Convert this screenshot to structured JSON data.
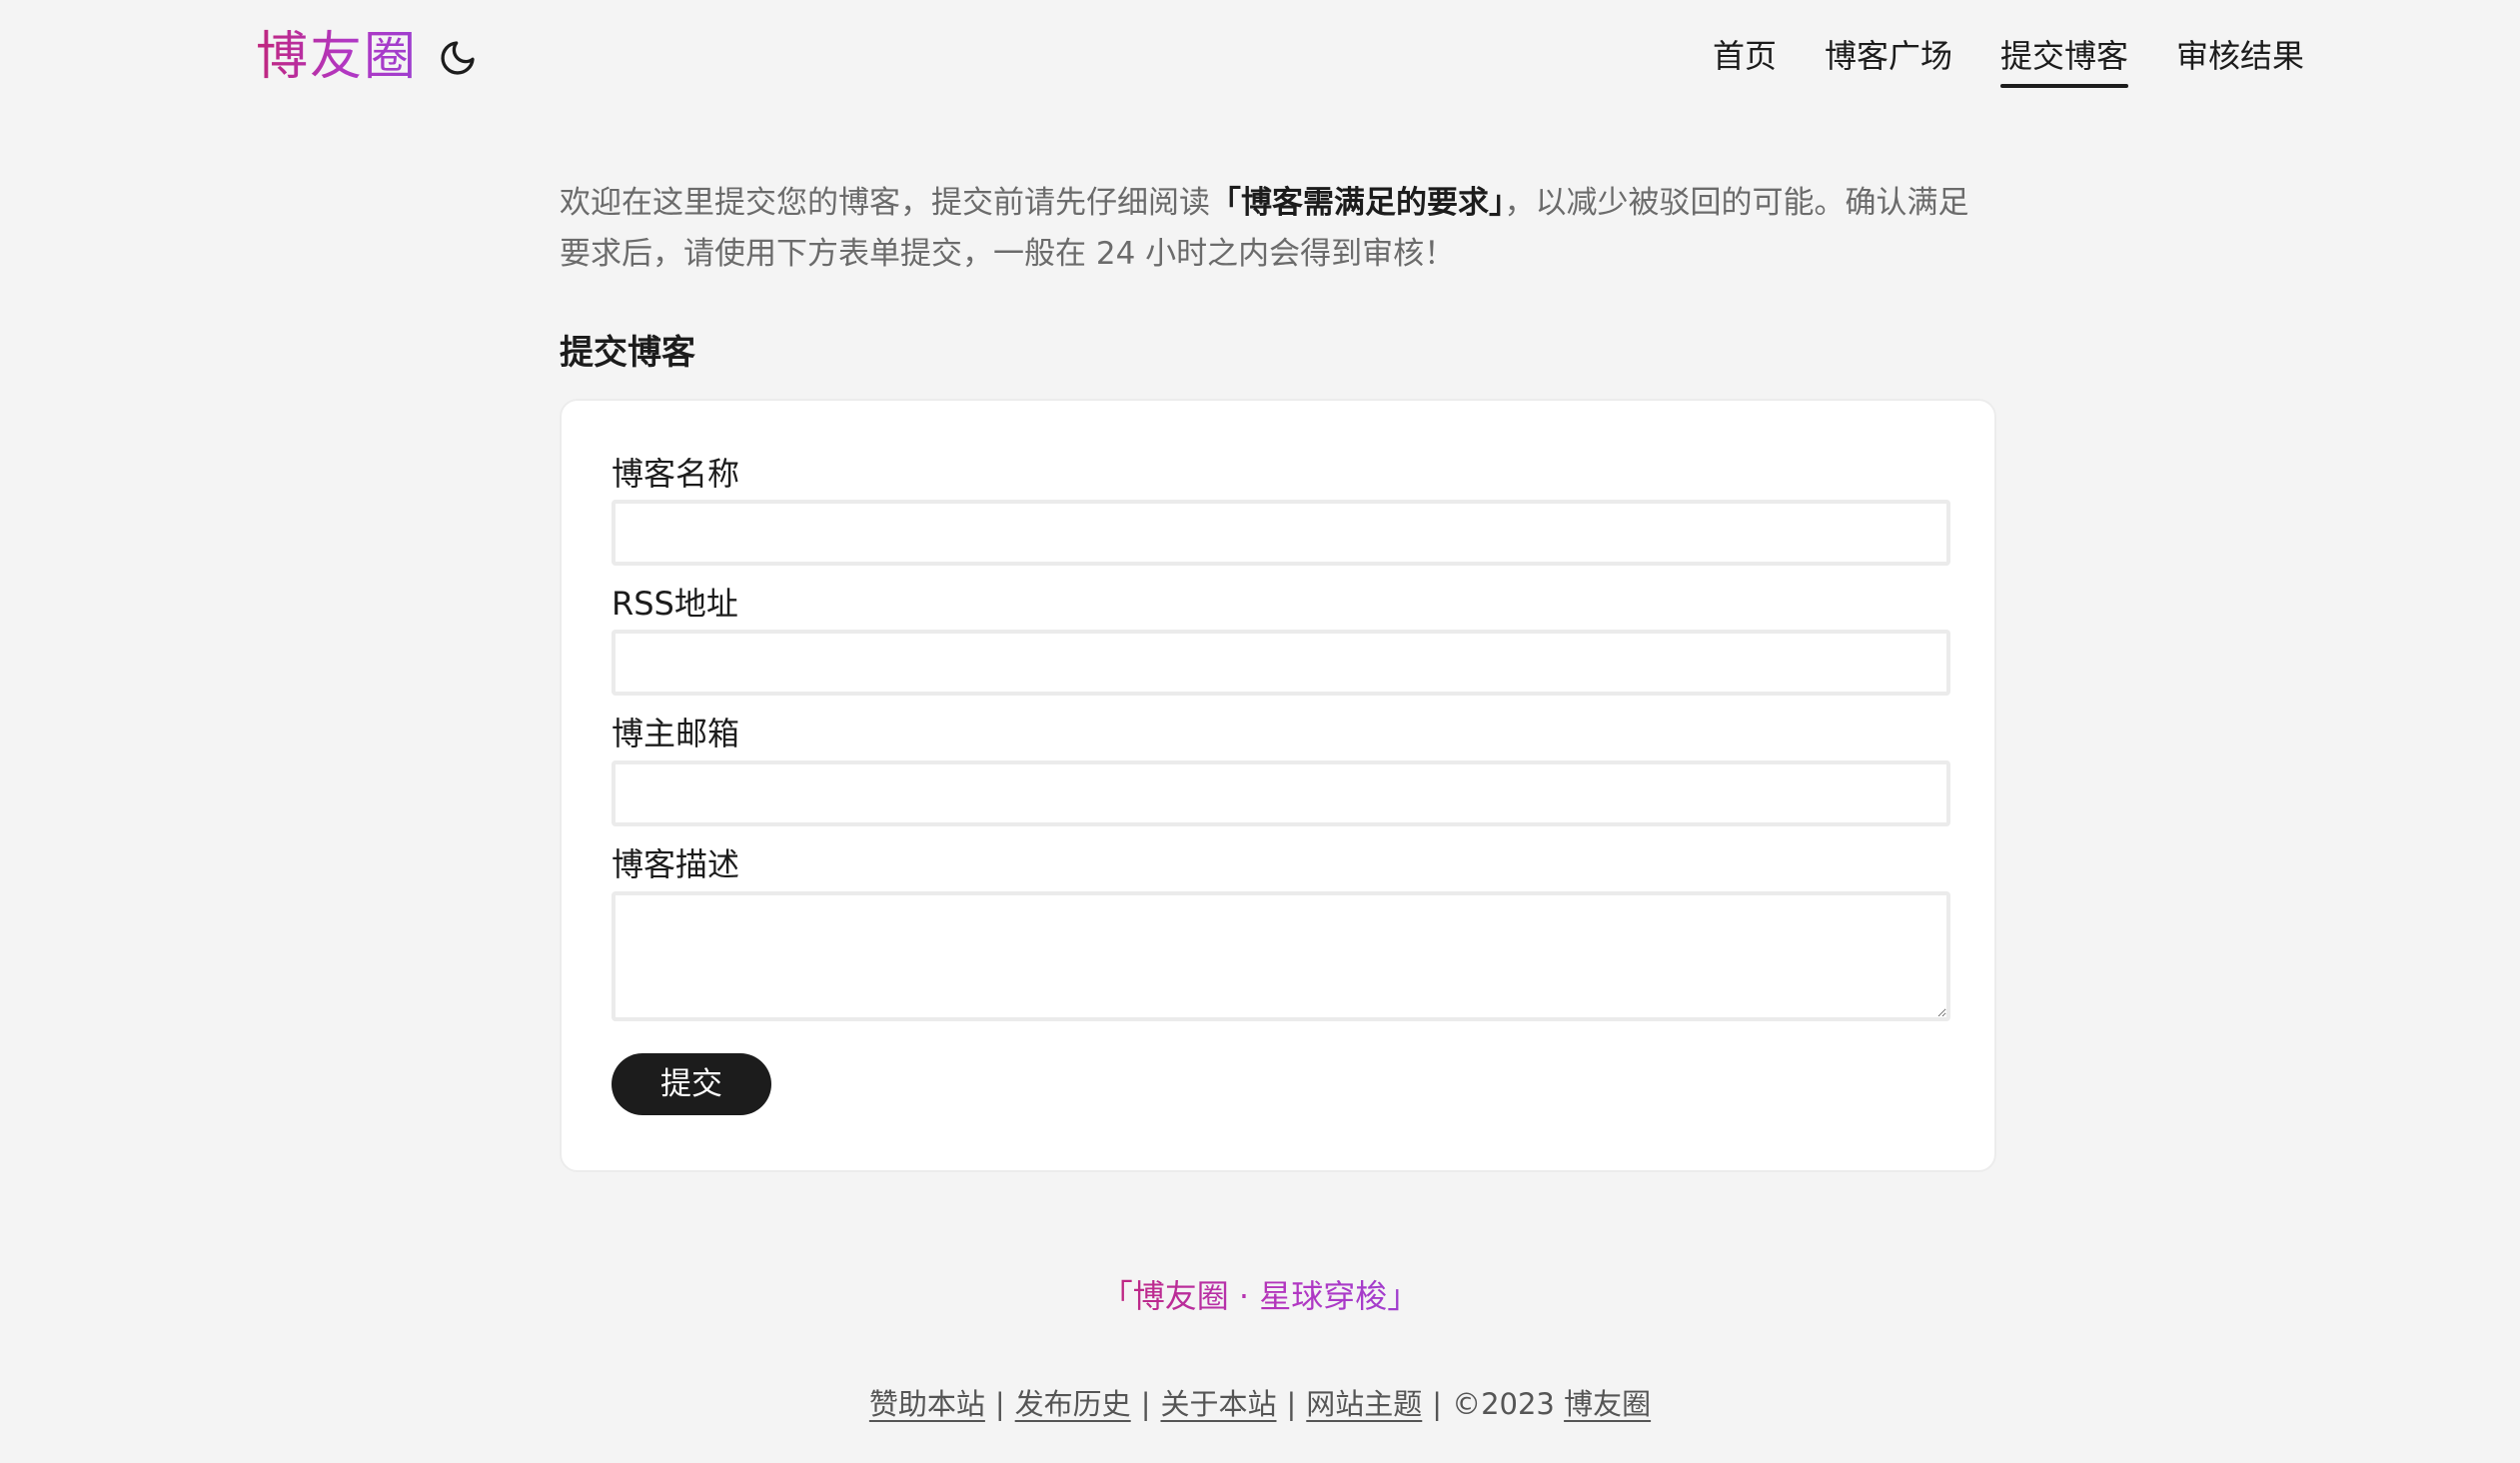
{
  "header": {
    "logo": "博友圈",
    "nav": [
      {
        "label": "首页",
        "active": false
      },
      {
        "label": "博客广场",
        "active": false
      },
      {
        "label": "提交博客",
        "active": true
      },
      {
        "label": "审核结果",
        "active": false
      }
    ]
  },
  "intro": {
    "part1": "欢迎在这里提交您的博客，提交前请先仔细阅读",
    "link": "「博客需满足的要求」",
    "part2": "，以减少被驳回的可能。确认满足要求后，请使用下方表单提交，一般在 24 小时之内会得到审核！"
  },
  "form": {
    "title": "提交博客",
    "fields": {
      "name": {
        "label": "博客名称",
        "value": ""
      },
      "rss": {
        "label": "RSS地址",
        "value": ""
      },
      "email": {
        "label": "博主邮箱",
        "value": ""
      },
      "description": {
        "label": "博客描述",
        "value": ""
      }
    },
    "submit_label": "提交"
  },
  "footer": {
    "tagline": "「博友圈 · 星球穿梭」",
    "links": [
      "赞助本站",
      "发布历史",
      "关于本站",
      "网站主题"
    ],
    "separator": "|",
    "copyright": "©2023",
    "brand": "博友圈"
  },
  "colors": {
    "background": "#f4f4f4",
    "accent_start": "#c0267c",
    "accent_end": "#9d3fd0",
    "button": "#1c1c1c"
  },
  "icons": {
    "theme_toggle": "moon-icon"
  }
}
